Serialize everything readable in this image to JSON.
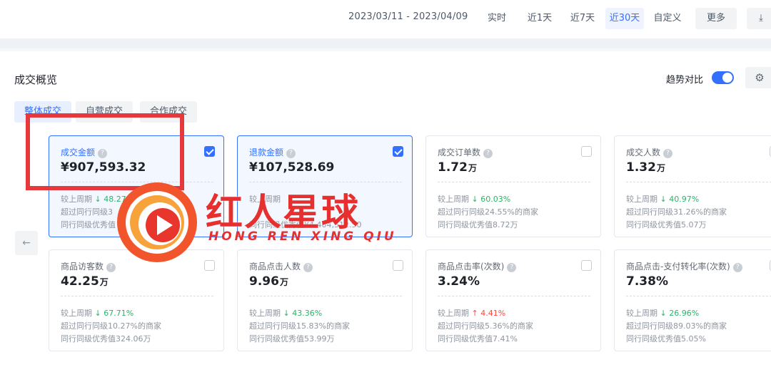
{
  "toolbar": {
    "date_range": "2023/03/11 - 2023/04/09",
    "ranges": [
      "实时",
      "近1天",
      "近7天",
      "近30天",
      "自定义"
    ],
    "active_range": "近30天",
    "more": "更多",
    "download_icon": "download-icon"
  },
  "section": {
    "title": "成交概览",
    "trend_label": "趋势对比",
    "trend_on": true,
    "tabs": [
      "整体成交",
      "自营成交",
      "合作成交"
    ]
  },
  "cards": [
    {
      "title": "成交金额",
      "value": "¥907,593.32",
      "unit": "",
      "checked": true,
      "l1_label": "较上周期",
      "l1_dir": "down",
      "l1_val": "48.27%",
      "l2": "超过同行同级3",
      "l3": "同行同级优秀值"
    },
    {
      "title": "退款金额",
      "value": "¥107,528.69",
      "unit": "",
      "checked": true,
      "l1_label": "较上周期",
      "l1_dir": "",
      "l1_val": "",
      "l2": "",
      "l3": "同行同级优秀值¥4,404,512.50"
    },
    {
      "title": "成交订单数",
      "value": "1.72",
      "unit": "万",
      "checked": false,
      "l1_label": "较上周期",
      "l1_dir": "down",
      "l1_val": "60.03%",
      "l2": "超过同行同级24.55%的商家",
      "l3": "同行同级优秀值8.72万"
    },
    {
      "title": "成交人数",
      "value": "1.32",
      "unit": "万",
      "checked": false,
      "l1_label": "较上周期",
      "l1_dir": "down",
      "l1_val": "40.97%",
      "l2": "超过同行同级31.26%的商家",
      "l3": "同行同级优秀值5.07万"
    },
    {
      "title": "商品访客数",
      "value": "42.25",
      "unit": "万",
      "checked": false,
      "l1_label": "较上周期",
      "l1_dir": "down",
      "l1_val": "67.71%",
      "l2": "超过同行同级10.27%的商家",
      "l3": "同行同级优秀值324.06万"
    },
    {
      "title": "商品点击人数",
      "value": "9.96",
      "unit": "万",
      "checked": false,
      "l1_label": "较上周期",
      "l1_dir": "down",
      "l1_val": "43.36%",
      "l2": "超过同行同级15.83%的商家",
      "l3": "同行同级优秀值53.99万"
    },
    {
      "title": "商品点击率(次数)",
      "value": "3.24%",
      "unit": "",
      "checked": false,
      "l1_label": "较上周期",
      "l1_dir": "up",
      "l1_val": "4.41%",
      "l2": "超过同行同级5.36%的商家",
      "l3": "同行同级优秀值7.41%"
    },
    {
      "title": "商品点击-支付转化率(次数)",
      "value": "7.38%",
      "unit": "",
      "checked": false,
      "l1_label": "较上周期",
      "l1_dir": "down",
      "l1_val": "26.96%",
      "l2": "超过同行同级89.03%的商家",
      "l3": "同行同级优秀值5.05%"
    }
  ],
  "watermark": {
    "text": "红人星球",
    "sub": "HONG REN XING QIU"
  },
  "colors": {
    "accent": "#3370ff",
    "positive_down": "#2bb567",
    "negative_up": "#f54a45",
    "annotation_red": "#e6393e"
  }
}
